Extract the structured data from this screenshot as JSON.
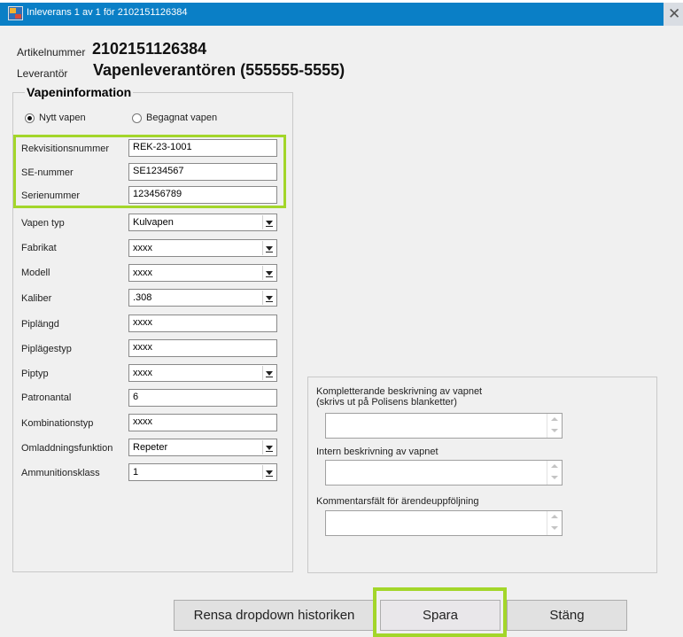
{
  "window": {
    "title": "Inleverans 1 av 1 för 2102151126384",
    "close_glyph": "✕"
  },
  "header": {
    "article_label": "Artikelnummer",
    "article_value": "2102151126384",
    "supplier_label": "Leverantör",
    "supplier_value": "Vapenleverantören (555555-5555)"
  },
  "weapon_info": {
    "title": "Vapeninformation",
    "radio_new": {
      "label": "Nytt vapen",
      "checked": true
    },
    "radio_used": {
      "label": "Begagnat vapen",
      "checked": false
    },
    "fields": [
      {
        "label": "Rekvisitionsnummer",
        "value": "REK-23-1001",
        "control": "text"
      },
      {
        "label": "SE-nummer",
        "value": "SE1234567",
        "control": "text"
      },
      {
        "label": "Serienummer",
        "value": "123456789",
        "control": "text"
      },
      {
        "label": "Vapen typ",
        "value": "Kulvapen",
        "control": "combo"
      },
      {
        "label": "Fabrikat",
        "value": "xxxx",
        "control": "combo"
      },
      {
        "label": "Modell",
        "value": "xxxx",
        "control": "combo"
      },
      {
        "label": "Kaliber",
        "value": ".308",
        "control": "combo"
      },
      {
        "label": "Piplängd",
        "value": "xxxx",
        "control": "text"
      },
      {
        "label": "Piplägestyp",
        "value": "xxxx",
        "control": "text"
      },
      {
        "label": "Piptyp",
        "value": "xxxx",
        "control": "combo"
      },
      {
        "label": "Patronantal",
        "value": "6",
        "control": "text"
      },
      {
        "label": "Kombinationstyp",
        "value": "xxxx",
        "control": "text"
      },
      {
        "label": "Omladdningsfunktion",
        "value": "Repeter",
        "control": "combo"
      },
      {
        "label": "Ammunitionsklass",
        "value": "1",
        "control": "combo"
      }
    ]
  },
  "descriptions": {
    "complementary_label_line1": "Kompletterande beskrivning av vapnet",
    "complementary_label_line2": "(skrivs ut på Polisens blanketter)",
    "complementary_value": "",
    "internal_label": "Intern beskrivning av vapnet",
    "internal_value": "",
    "comment_label": "Kommentarsfält för ärendeuppföljning",
    "comment_value": ""
  },
  "buttons": {
    "clear_history": "Rensa dropdown historiken",
    "save": "Spara",
    "close": "Stäng"
  },
  "highlight_color": "#a3d62a",
  "titlebar_color": "#0a7fc6",
  "icons": [
    "app-icon",
    "close-icon",
    "dropdown-arrow-icon",
    "scroll-up-icon",
    "scroll-down-icon"
  ]
}
